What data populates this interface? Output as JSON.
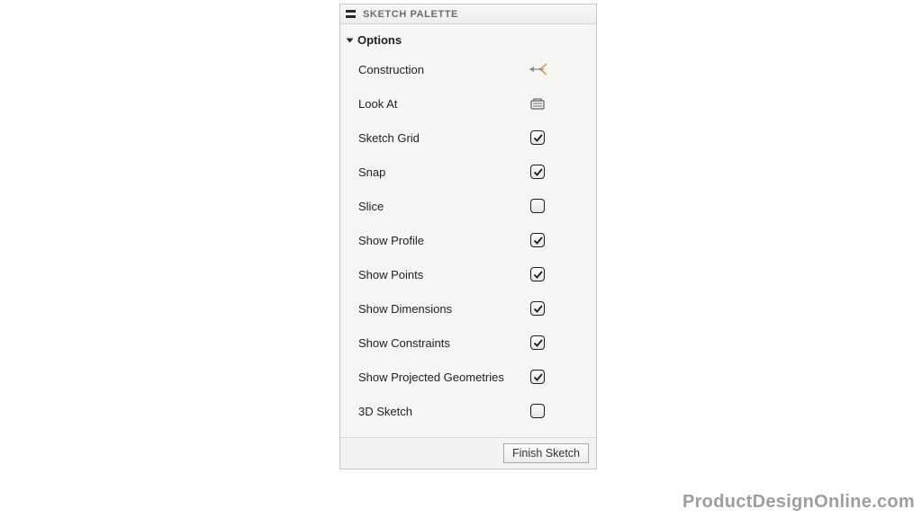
{
  "panel": {
    "title": "SKETCH PALETTE",
    "section_title": "Options",
    "rows": [
      {
        "label": "Construction",
        "type": "icon",
        "icon": "compass-icon"
      },
      {
        "label": "Look At",
        "type": "icon",
        "icon": "look-at-icon"
      },
      {
        "label": "Sketch Grid",
        "type": "checkbox",
        "checked": true
      },
      {
        "label": "Snap",
        "type": "checkbox",
        "checked": true
      },
      {
        "label": "Slice",
        "type": "checkbox",
        "checked": false
      },
      {
        "label": "Show Profile",
        "type": "checkbox",
        "checked": true
      },
      {
        "label": "Show Points",
        "type": "checkbox",
        "checked": true
      },
      {
        "label": "Show Dimensions",
        "type": "checkbox",
        "checked": true
      },
      {
        "label": "Show Constraints",
        "type": "checkbox",
        "checked": true
      },
      {
        "label": "Show Projected Geometries",
        "type": "checkbox",
        "checked": true
      },
      {
        "label": "3D Sketch",
        "type": "checkbox",
        "checked": false
      }
    ],
    "finish_label": "Finish Sketch"
  },
  "watermark": "ProductDesignOnline.com"
}
